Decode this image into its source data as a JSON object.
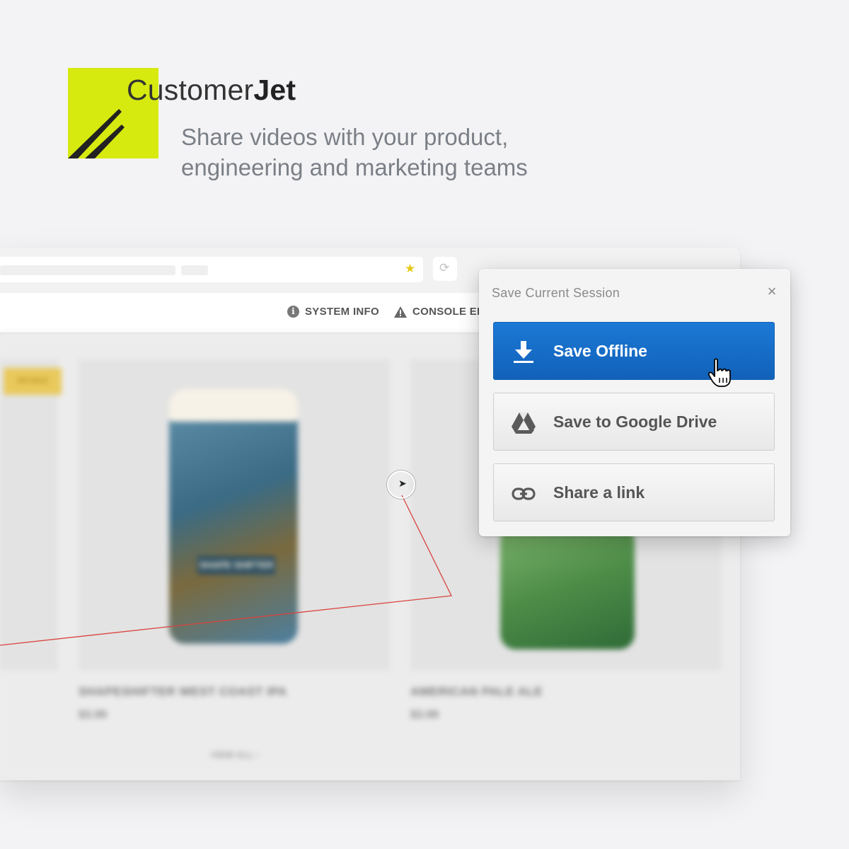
{
  "brand": {
    "name_regular": "Customer",
    "name_bold": "Jet",
    "logo_color": "#d7ea0f",
    "tagline_lines": [
      "Share videos with your product,",
      "engineering and marketing teams"
    ]
  },
  "browser": {
    "devbar": {
      "system_info_label": "SYSTEM INFO",
      "console_label": "CONSOLE ER"
    },
    "products": [
      {
        "name": "SHAPESHIFTER WEST COAST IPA",
        "price": "$3.99",
        "can_label": "SHAPE SHIFTER"
      },
      {
        "name": "AMERICAN PALE ALE",
        "price": "$3.99"
      }
    ],
    "sale_badge": "ON SALE",
    "view_all": "VIEW ALL  ›"
  },
  "popup": {
    "title": "Save Current Session",
    "close_symbol": "×",
    "buttons": {
      "offline": "Save Offline",
      "drive": "Save to Google Drive",
      "link": "Share a link"
    },
    "accent_color": "#1b79d6"
  }
}
